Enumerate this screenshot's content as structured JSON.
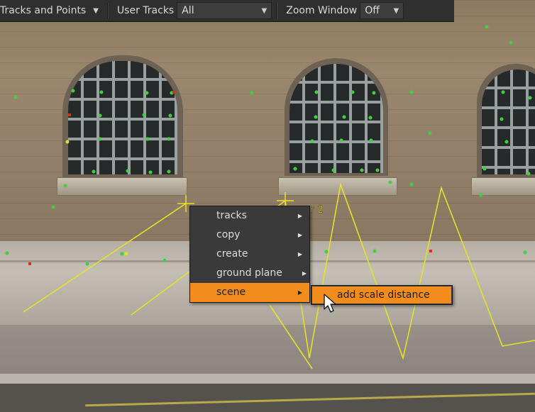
{
  "toolbar": {
    "tracks_mode": "Tracks and Points",
    "user_tracks_label": "User Tracks",
    "user_tracks_value": "All",
    "zoom_window_label": "Zoom Window",
    "zoom_window_value": "Off"
  },
  "viewer": {
    "track_label": "r 2"
  },
  "context_menu": {
    "items": [
      {
        "label": "tracks"
      },
      {
        "label": "copy"
      },
      {
        "label": "create"
      },
      {
        "label": "ground plane"
      },
      {
        "label": "scene"
      }
    ],
    "active_item": "scene",
    "submenu": {
      "items": [
        {
          "label": "add scale distance"
        }
      ]
    }
  },
  "colors": {
    "accent": "#f28c1c",
    "track_point": "#3fd23f",
    "track_line": "#e6e02a",
    "menu_bg": "#3a3a3a",
    "toolbar_bg": "#2f2f2f"
  }
}
